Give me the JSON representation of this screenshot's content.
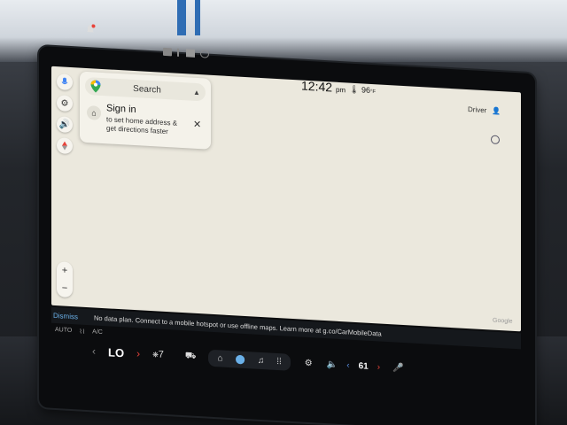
{
  "status": {
    "time": "12:42",
    "ampm": "pm",
    "temperature": "96",
    "temp_unit": "°F",
    "driver_label": "Driver"
  },
  "map": {
    "search_placeholder": "Search",
    "signin_title": "Sign in",
    "signin_desc": "to set home address & get directions faster",
    "attribution": "Google",
    "zoom_in": "+",
    "zoom_out": "−"
  },
  "notice": {
    "dismiss_label": "Dismiss",
    "message": "No data plan. Connect to a mobile hotspot or use offline maps. Learn more at g.co/CarMobileData"
  },
  "climate": {
    "auto_label": "AUTO",
    "ac_label": "A/C",
    "left_temp": "LO",
    "fan_speed": "7"
  },
  "volume": {
    "level": "61"
  },
  "icons": {
    "bell": "bell-icon",
    "mic": "mic-icon",
    "settings": "gear-icon",
    "sound": "speaker-icon",
    "compass": "compass-icon",
    "home": "home-icon",
    "nav": "navigation-icon",
    "music": "music-icon",
    "apps": "apps-grid-icon",
    "car": "car-icon"
  },
  "colors": {
    "map_bg": "#ebe8dd",
    "accent_blue": "#6ab0e8",
    "accent_red": "#e8433a"
  }
}
